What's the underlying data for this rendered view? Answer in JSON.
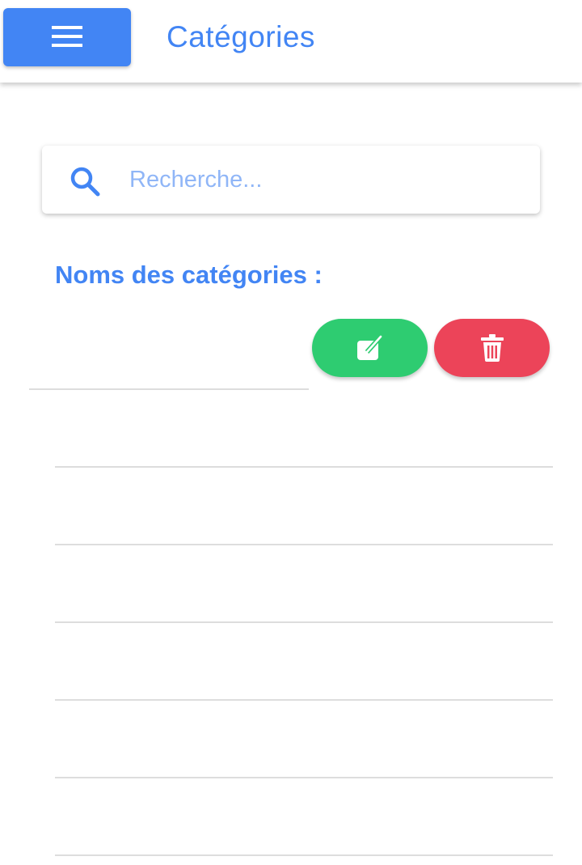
{
  "header": {
    "title": "Catégories",
    "menu_icon": "hamburger-menu-icon",
    "accent_color": "#4285f4"
  },
  "search": {
    "placeholder": "Recherche...",
    "value": "",
    "icon": "search-icon"
  },
  "list": {
    "title": "Noms des catégories :",
    "rows": [
      {
        "label": ""
      },
      {
        "label": ""
      },
      {
        "label": ""
      },
      {
        "label": ""
      },
      {
        "label": ""
      },
      {
        "label": ""
      },
      {
        "label": ""
      }
    ],
    "edit_color": "#2ecc71",
    "delete_color": "#ec4459",
    "edit_icon": "edit-icon",
    "delete_icon": "trash-icon"
  }
}
